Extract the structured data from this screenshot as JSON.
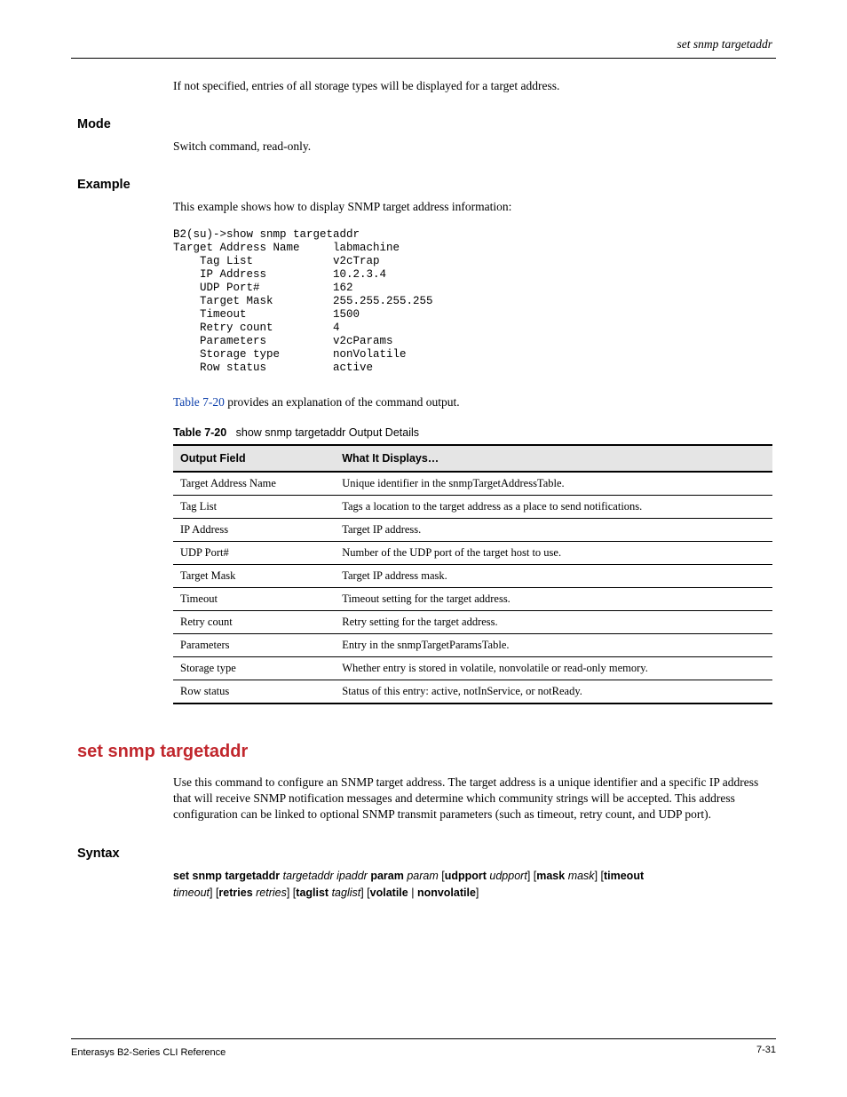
{
  "header": {
    "right": "set snmp targetaddr"
  },
  "defaults": {
    "text": "If not specified, entries of all storage types will be displayed for a target address."
  },
  "mode": {
    "heading": "Mode",
    "text": "Switch command, read-only."
  },
  "example": {
    "heading": "Example",
    "text": "This example shows how to display SNMP target address information:",
    "code": "B2(su)->show snmp targetaddr\nTarget Address Name     labmachine\n    Tag List            v2cTrap\n    IP Address          10.2.3.4\n    UDP Port#           162\n    Target Mask         255.255.255.255\n    Timeout             1500\n    Retry count         4\n    Parameters          v2cParams\n    Storage type        nonVolatile\n    Row status          active",
    "after_link": "Table 7-20",
    "after_text": " provides an explanation of the command output."
  },
  "table": {
    "title_prefix": "Table 7-20",
    "title_rest": "show snmp targetaddr Output Details",
    "heads": [
      "Output Field",
      "What It Displays…"
    ],
    "rows": [
      [
        "Target Address Name",
        "Unique identifier in the snmpTargetAddressTable."
      ],
      [
        "Tag List",
        "Tags a location to the target address as a place to send notifications."
      ],
      [
        "IP Address",
        "Target IP address."
      ],
      [
        "UDP Port#",
        "Number of the UDP port of the target host to use."
      ],
      [
        "Target Mask",
        "Target IP address mask."
      ],
      [
        "Timeout",
        "Timeout setting for the target address."
      ],
      [
        "Retry count",
        "Retry setting for the target address."
      ],
      [
        "Parameters",
        "Entry in the snmpTargetParamsTable."
      ],
      [
        "Storage type",
        "Whether entry is stored in volatile, nonvolatile or read-only memory."
      ],
      [
        "Row status",
        "Status of this entry: active, notInService, or notReady."
      ]
    ]
  },
  "set_cmd": {
    "title": "set snmp targetaddr",
    "desc": "Use this command to configure an SNMP target address. The target address is a unique identifier and a specific IP address that will receive SNMP notification messages and determine which community strings will be accepted. This address configuration can be linked to optional SNMP transmit parameters (such as timeout, retry count, and UDP port).",
    "syntax_heading": "Syntax",
    "syntax_tokens": [
      {
        "kw": "set snmp targetaddr "
      },
      {
        "arg": "targetaddr ipaddr "
      },
      {
        "kw": "param "
      },
      {
        "arg": "param "
      },
      {
        "txt": "["
      },
      {
        "kw": "udpport "
      },
      {
        "arg": "udpport"
      },
      {
        "txt": "] ["
      },
      {
        "kw": "mask "
      },
      {
        "arg": "mask"
      },
      {
        "txt": "] ["
      },
      {
        "kw": "timeout"
      },
      {
        "br": true
      },
      {
        "arg": "timeout"
      },
      {
        "txt": "] ["
      },
      {
        "kw": "retries "
      },
      {
        "arg": "retries"
      },
      {
        "txt": "] ["
      },
      {
        "kw": "taglist "
      },
      {
        "arg": "taglist"
      },
      {
        "txt": "] ["
      },
      {
        "kw": "volatile "
      },
      {
        "txt": "| "
      },
      {
        "kw": "nonvolatile"
      },
      {
        "txt": "]"
      }
    ]
  },
  "footer": {
    "left": "Enterasys B2-Series CLI Reference",
    "right": "7-31"
  }
}
